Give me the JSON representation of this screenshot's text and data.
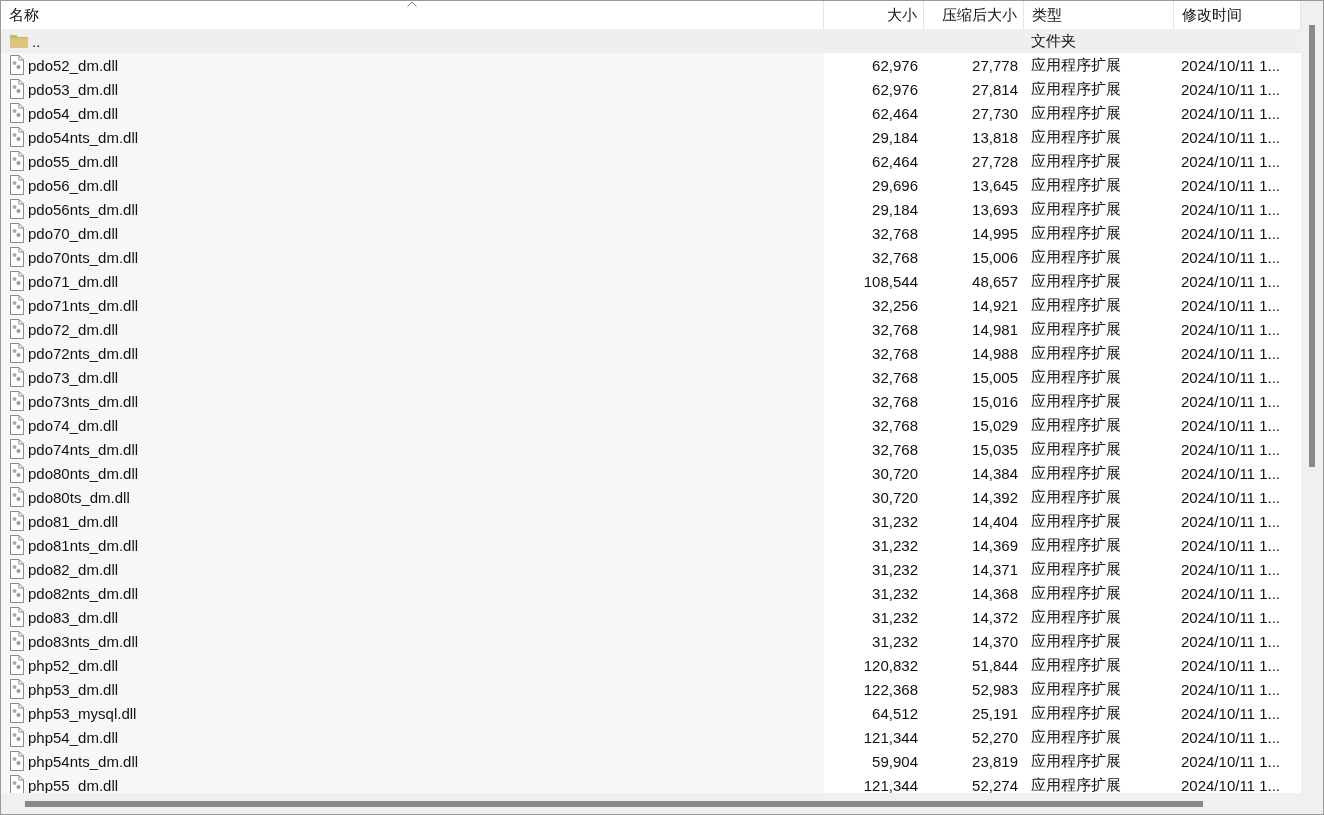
{
  "columns": [
    {
      "label": "名称",
      "kind": "text",
      "sorted": true
    },
    {
      "label": "大小",
      "kind": "numeric",
      "sorted": false
    },
    {
      "label": "压缩后大小",
      "kind": "numeric",
      "sorted": false
    },
    {
      "label": "类型",
      "kind": "text",
      "sorted": false
    },
    {
      "label": "修改时间",
      "kind": "text",
      "sorted": false
    }
  ],
  "rows": [
    {
      "kind": "folder",
      "selected": true,
      "name": "..",
      "type": "文件夹"
    },
    {
      "kind": "file",
      "selected": false,
      "name": "pdo52_dm.dll",
      "size": "62,976",
      "packed": "27,778",
      "type": "应用程序扩展",
      "modified": "2024/10/11 1..."
    },
    {
      "kind": "file",
      "selected": false,
      "name": "pdo53_dm.dll",
      "size": "62,976",
      "packed": "27,814",
      "type": "应用程序扩展",
      "modified": "2024/10/11 1..."
    },
    {
      "kind": "file",
      "selected": false,
      "name": "pdo54_dm.dll",
      "size": "62,464",
      "packed": "27,730",
      "type": "应用程序扩展",
      "modified": "2024/10/11 1..."
    },
    {
      "kind": "file",
      "selected": false,
      "name": "pdo54nts_dm.dll",
      "size": "29,184",
      "packed": "13,818",
      "type": "应用程序扩展",
      "modified": "2024/10/11 1..."
    },
    {
      "kind": "file",
      "selected": false,
      "name": "pdo55_dm.dll",
      "size": "62,464",
      "packed": "27,728",
      "type": "应用程序扩展",
      "modified": "2024/10/11 1..."
    },
    {
      "kind": "file",
      "selected": false,
      "name": "pdo56_dm.dll",
      "size": "29,696",
      "packed": "13,645",
      "type": "应用程序扩展",
      "modified": "2024/10/11 1..."
    },
    {
      "kind": "file",
      "selected": false,
      "name": "pdo56nts_dm.dll",
      "size": "29,184",
      "packed": "13,693",
      "type": "应用程序扩展",
      "modified": "2024/10/11 1..."
    },
    {
      "kind": "file",
      "selected": false,
      "name": "pdo70_dm.dll",
      "size": "32,768",
      "packed": "14,995",
      "type": "应用程序扩展",
      "modified": "2024/10/11 1..."
    },
    {
      "kind": "file",
      "selected": false,
      "name": "pdo70nts_dm.dll",
      "size": "32,768",
      "packed": "15,006",
      "type": "应用程序扩展",
      "modified": "2024/10/11 1..."
    },
    {
      "kind": "file",
      "selected": false,
      "name": "pdo71_dm.dll",
      "size": "108,544",
      "packed": "48,657",
      "type": "应用程序扩展",
      "modified": "2024/10/11 1..."
    },
    {
      "kind": "file",
      "selected": false,
      "name": "pdo71nts_dm.dll",
      "size": "32,256",
      "packed": "14,921",
      "type": "应用程序扩展",
      "modified": "2024/10/11 1..."
    },
    {
      "kind": "file",
      "selected": false,
      "name": "pdo72_dm.dll",
      "size": "32,768",
      "packed": "14,981",
      "type": "应用程序扩展",
      "modified": "2024/10/11 1..."
    },
    {
      "kind": "file",
      "selected": false,
      "name": "pdo72nts_dm.dll",
      "size": "32,768",
      "packed": "14,988",
      "type": "应用程序扩展",
      "modified": "2024/10/11 1..."
    },
    {
      "kind": "file",
      "selected": false,
      "name": "pdo73_dm.dll",
      "size": "32,768",
      "packed": "15,005",
      "type": "应用程序扩展",
      "modified": "2024/10/11 1..."
    },
    {
      "kind": "file",
      "selected": false,
      "name": "pdo73nts_dm.dll",
      "size": "32,768",
      "packed": "15,016",
      "type": "应用程序扩展",
      "modified": "2024/10/11 1..."
    },
    {
      "kind": "file",
      "selected": false,
      "name": "pdo74_dm.dll",
      "size": "32,768",
      "packed": "15,029",
      "type": "应用程序扩展",
      "modified": "2024/10/11 1..."
    },
    {
      "kind": "file",
      "selected": false,
      "name": "pdo74nts_dm.dll",
      "size": "32,768",
      "packed": "15,035",
      "type": "应用程序扩展",
      "modified": "2024/10/11 1..."
    },
    {
      "kind": "file",
      "selected": false,
      "name": "pdo80nts_dm.dll",
      "size": "30,720",
      "packed": "14,384",
      "type": "应用程序扩展",
      "modified": "2024/10/11 1..."
    },
    {
      "kind": "file",
      "selected": false,
      "name": "pdo80ts_dm.dll",
      "size": "30,720",
      "packed": "14,392",
      "type": "应用程序扩展",
      "modified": "2024/10/11 1..."
    },
    {
      "kind": "file",
      "selected": false,
      "name": "pdo81_dm.dll",
      "size": "31,232",
      "packed": "14,404",
      "type": "应用程序扩展",
      "modified": "2024/10/11 1..."
    },
    {
      "kind": "file",
      "selected": false,
      "name": "pdo81nts_dm.dll",
      "size": "31,232",
      "packed": "14,369",
      "type": "应用程序扩展",
      "modified": "2024/10/11 1..."
    },
    {
      "kind": "file",
      "selected": false,
      "name": "pdo82_dm.dll",
      "size": "31,232",
      "packed": "14,371",
      "type": "应用程序扩展",
      "modified": "2024/10/11 1..."
    },
    {
      "kind": "file",
      "selected": false,
      "name": "pdo82nts_dm.dll",
      "size": "31,232",
      "packed": "14,368",
      "type": "应用程序扩展",
      "modified": "2024/10/11 1..."
    },
    {
      "kind": "file",
      "selected": false,
      "name": "pdo83_dm.dll",
      "size": "31,232",
      "packed": "14,372",
      "type": "应用程序扩展",
      "modified": "2024/10/11 1..."
    },
    {
      "kind": "file",
      "selected": false,
      "name": "pdo83nts_dm.dll",
      "size": "31,232",
      "packed": "14,370",
      "type": "应用程序扩展",
      "modified": "2024/10/11 1..."
    },
    {
      "kind": "file",
      "selected": false,
      "name": "php52_dm.dll",
      "size": "120,832",
      "packed": "51,844",
      "type": "应用程序扩展",
      "modified": "2024/10/11 1..."
    },
    {
      "kind": "file",
      "selected": false,
      "name": "php53_dm.dll",
      "size": "122,368",
      "packed": "52,983",
      "type": "应用程序扩展",
      "modified": "2024/10/11 1..."
    },
    {
      "kind": "file",
      "selected": false,
      "name": "php53_mysql.dll",
      "size": "64,512",
      "packed": "25,191",
      "type": "应用程序扩展",
      "modified": "2024/10/11 1..."
    },
    {
      "kind": "file",
      "selected": false,
      "name": "php54_dm.dll",
      "size": "121,344",
      "packed": "52,270",
      "type": "应用程序扩展",
      "modified": "2024/10/11 1..."
    },
    {
      "kind": "file",
      "selected": false,
      "name": "php54nts_dm.dll",
      "size": "59,904",
      "packed": "23,819",
      "type": "应用程序扩展",
      "modified": "2024/10/11 1..."
    },
    {
      "kind": "file",
      "selected": false,
      "name": "php55_dm.dll",
      "size": "121,344",
      "packed": "52,274",
      "type": "应用程序扩展",
      "modified": "2024/10/11 1..."
    }
  ]
}
